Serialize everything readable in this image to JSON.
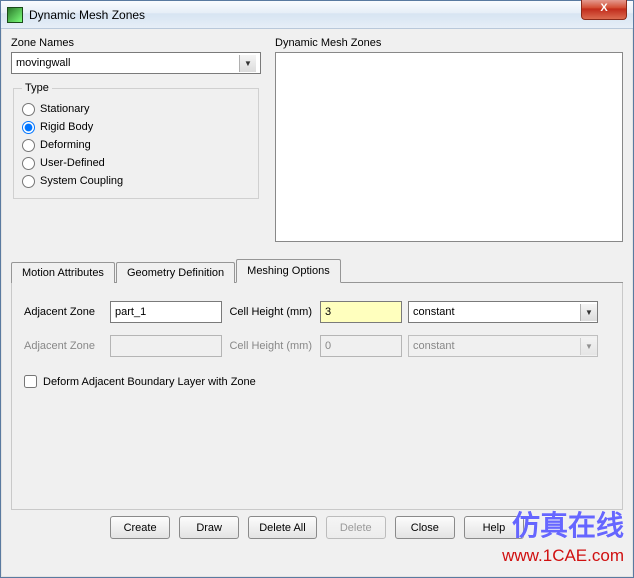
{
  "window": {
    "title": "Dynamic Mesh Zones",
    "close_symbol": "X"
  },
  "zone_names": {
    "label": "Zone Names",
    "selected": "movingwall"
  },
  "dynamic_mesh_zones": {
    "label": "Dynamic Mesh Zones"
  },
  "type": {
    "legend": "Type",
    "options": [
      {
        "value": "stationary",
        "label": "Stationary"
      },
      {
        "value": "rigid_body",
        "label": "Rigid Body"
      },
      {
        "value": "deforming",
        "label": "Deforming"
      },
      {
        "value": "user_defined",
        "label": "User-Defined"
      },
      {
        "value": "system_coupling",
        "label": "System Coupling"
      }
    ],
    "selected": "rigid_body"
  },
  "tabs": {
    "items": [
      {
        "id": "motion",
        "label": "Motion Attributes"
      },
      {
        "id": "geometry",
        "label": "Geometry Definition"
      },
      {
        "id": "meshing",
        "label": "Meshing Options"
      }
    ],
    "active": "meshing"
  },
  "meshing": {
    "row1": {
      "adj_label": "Adjacent Zone",
      "adj_value": "part_1",
      "ch_label": "Cell Height (mm)",
      "ch_value": "3",
      "mode": "constant"
    },
    "row2": {
      "adj_label": "Adjacent Zone",
      "adj_value": "",
      "ch_label": "Cell Height (mm)",
      "ch_value": "0",
      "mode": "constant"
    },
    "deform_label": "Deform Adjacent Boundary Layer with Zone"
  },
  "buttons": {
    "create": "Create",
    "draw": "Draw",
    "delete_all": "Delete All",
    "delete": "Delete",
    "close": "Close",
    "help": "Help"
  },
  "watermark": {
    "cn": "仿真在线",
    "url": "www.1CAE.com"
  }
}
